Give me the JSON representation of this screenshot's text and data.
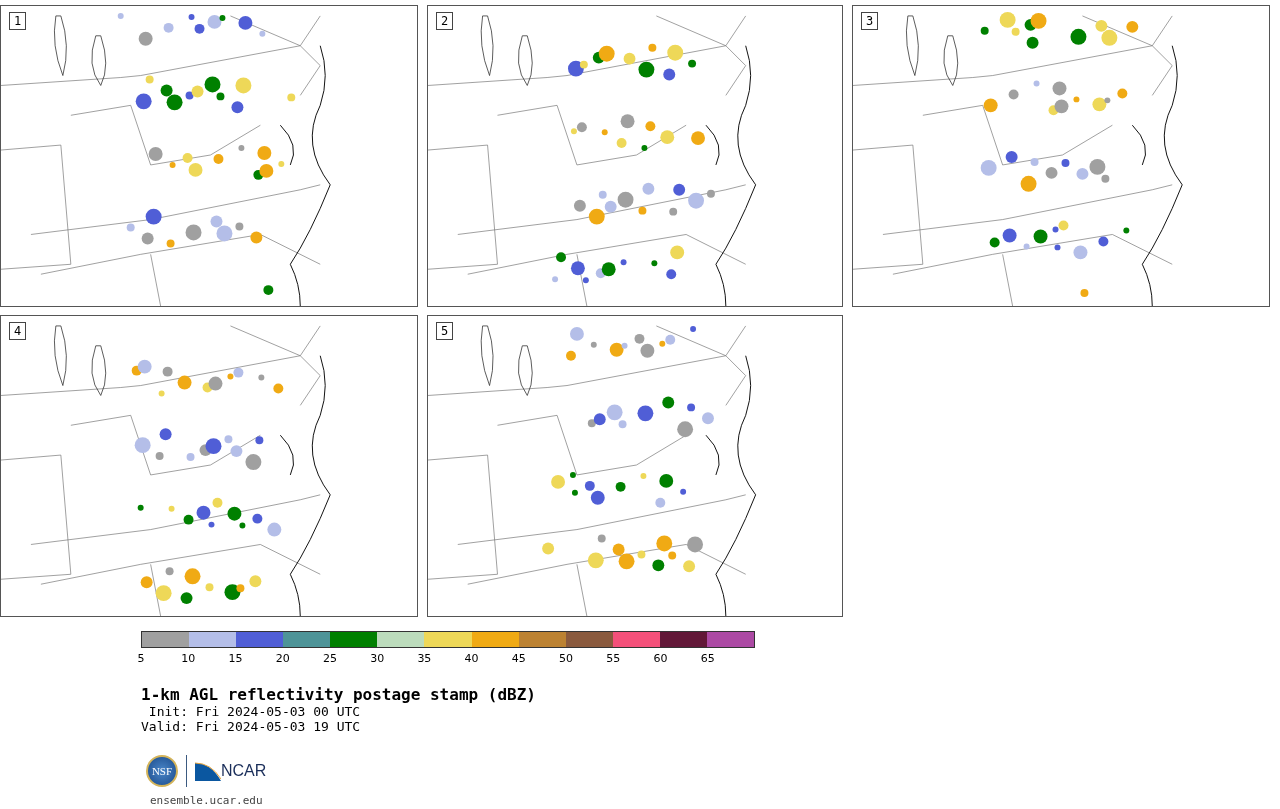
{
  "panels": [
    {
      "label": "1"
    },
    {
      "label": "2"
    },
    {
      "label": "3"
    },
    {
      "label": "4"
    },
    {
      "label": "5"
    }
  ],
  "colorbar": {
    "segments": [
      {
        "color": "#a0a0a0"
      },
      {
        "color": "#b4bee8"
      },
      {
        "color": "#505ed6"
      },
      {
        "color": "#4e9498"
      },
      {
        "color": "#008000"
      },
      {
        "color": "#bcdcbc"
      },
      {
        "color": "#eed858"
      },
      {
        "color": "#f0aa14"
      },
      {
        "color": "#bc8232"
      },
      {
        "color": "#8a5a3e"
      },
      {
        "color": "#f4507a"
      },
      {
        "color": "#621838"
      },
      {
        "color": "#ac4aa4"
      }
    ],
    "ticks": [
      "5",
      "10",
      "15",
      "20",
      "25",
      "30",
      "35",
      "40",
      "45",
      "50",
      "55",
      "60",
      "65"
    ]
  },
  "title": "1-km AGL reflectivity postage stamp (dBZ)",
  "init": " Init: Fri 2024-05-03 00 UTC",
  "valid": "Valid: Fri 2024-05-03 19 UTC",
  "logos": {
    "nsf": "NSF",
    "ncar": "NCAR"
  },
  "url": "ensemble.ucar.edu"
}
